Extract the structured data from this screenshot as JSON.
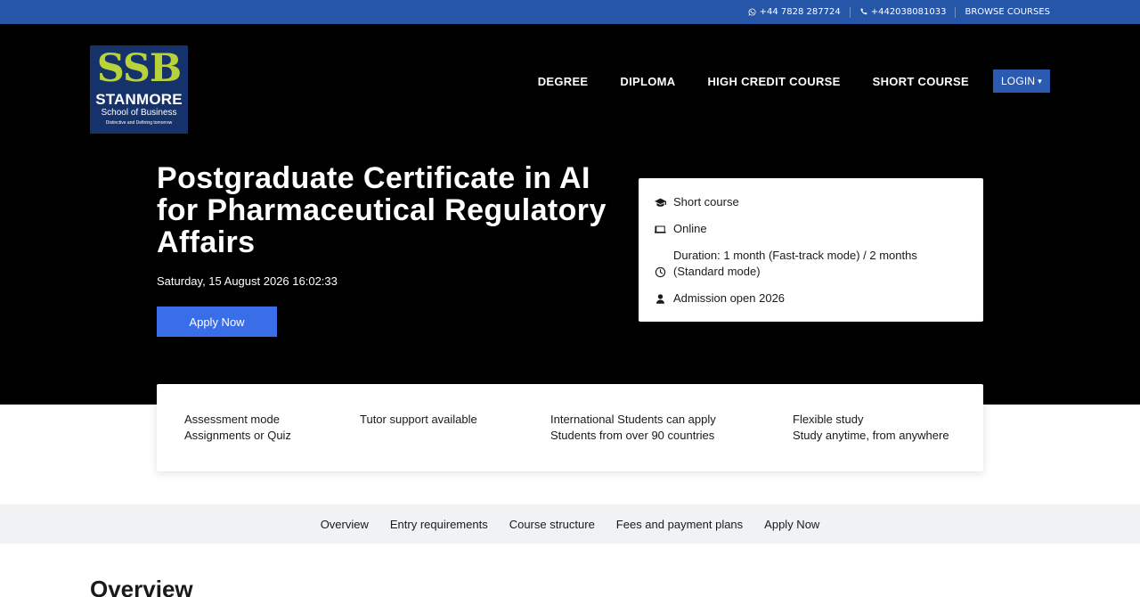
{
  "topbar": {
    "whatsapp_icon": "whatsapp-icon",
    "whatsapp": "+44 7828 287724",
    "phone_icon": "phone-icon",
    "phone": "+442038081033",
    "browse": "BROWSE COURSES"
  },
  "logo": {
    "letters": "SSB",
    "name": "STANMORE",
    "subtitle": "School of Business",
    "tagline": "Distinctive and Defining tomorrow"
  },
  "nav": {
    "items": [
      "DEGREE",
      "DIPLOMA",
      "HIGH CREDIT COURSE",
      "SHORT COURSE"
    ],
    "login": "LOGIN",
    "login_caret": "▾"
  },
  "hero": {
    "title": "Postgraduate Certificate in AI for Pharmaceutical Regulatory Affairs",
    "datetime": "Saturday, 15 August 2026 16:02:33",
    "apply_label": "Apply Now"
  },
  "info": {
    "type_icon": "graduation-cap-icon",
    "type": "Short course",
    "mode_icon": "laptop-icon",
    "mode": "Online",
    "duration_icon": "clock-icon",
    "duration": "Duration: 1 month (Fast-track mode) / 2 months (Standard mode)",
    "admission_icon": "user-icon",
    "admission": "Admission open 2026"
  },
  "features": [
    {
      "line1": "Assessment mode",
      "line2": "Assignments or Quiz"
    },
    {
      "line1": "Tutor support available",
      "line2": ""
    },
    {
      "line1": "International Students can apply",
      "line2": "Students from over 90 countries"
    },
    {
      "line1": "Flexible study",
      "line2": "Study anytime, from anywhere"
    }
  ],
  "tabs": [
    "Overview",
    "Entry requirements",
    "Course structure",
    "Fees and payment plans",
    "Apply Now"
  ],
  "overview_heading": "Overview",
  "colors": {
    "topbar": "#2656a8",
    "header_bg": "#000000",
    "apply_button": "#3a6ee8",
    "login_button": "#2a5bb0",
    "logo_bg": "#15326b",
    "logo_accent": "#b7d23a",
    "tabs_bg": "#f1f2f4"
  }
}
